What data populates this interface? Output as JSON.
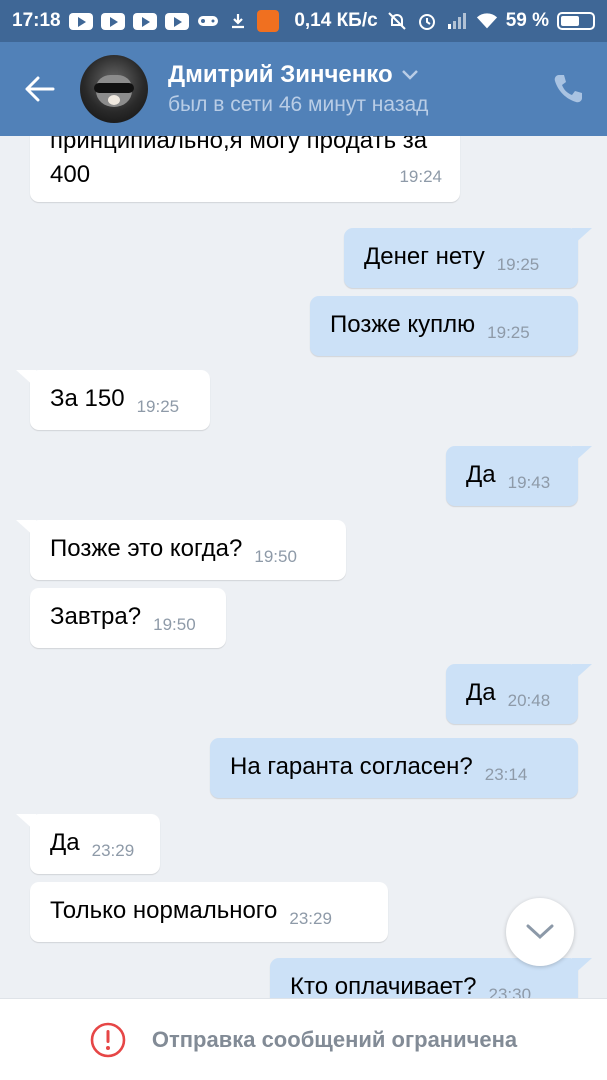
{
  "status_bar": {
    "time": "17:18",
    "speed": "0,14 КБ/с",
    "battery": "59 %",
    "battery_level": 0.59
  },
  "header": {
    "name": "Дмитрий Зинченко",
    "status": "был в сети 46 минут назад"
  },
  "messages": [
    {
      "dir": "in",
      "text": "принципиально,я могу продать за 400",
      "time": "19:24"
    },
    {
      "dir": "out",
      "text": "Денег нету",
      "time": "19:25"
    },
    {
      "dir": "out",
      "text": "Позже куплю",
      "time": "19:25"
    },
    {
      "dir": "in",
      "text": "За 150",
      "time": "19:25"
    },
    {
      "dir": "out",
      "text": "Да",
      "time": "19:43"
    },
    {
      "dir": "in",
      "text": "Позже это когда?",
      "time": "19:50"
    },
    {
      "dir": "in",
      "text": "Завтра?",
      "time": "19:50"
    },
    {
      "dir": "out",
      "text": "Да",
      "time": "20:48"
    },
    {
      "dir": "out",
      "text": "На гаранта согласен?",
      "time": "23:14"
    },
    {
      "dir": "in",
      "text": "Да",
      "time": "23:29"
    },
    {
      "dir": "in",
      "text": "Только нормального",
      "time": "23:29"
    },
    {
      "dir": "out",
      "text": "Кто оплачивает?",
      "time": "23:30"
    }
  ],
  "footer": {
    "notice": "Отправка сообщений ограничена"
  },
  "colors": {
    "header_bg": "#5181b8",
    "status_bar_bg": "#3f6796",
    "outgoing_bubble": "#cce1f7",
    "incoming_bubble": "#ffffff",
    "chat_bg": "#edf0f4",
    "warning_red": "#e64646"
  }
}
